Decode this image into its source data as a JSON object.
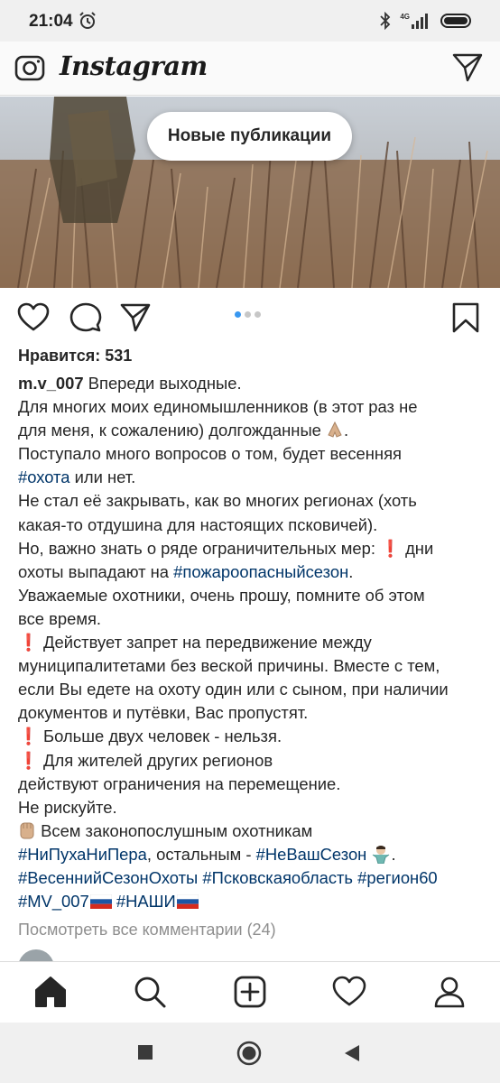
{
  "status_bar": {
    "time": "21:04",
    "network": "4G"
  },
  "app": {
    "title": "Instagram",
    "new_posts_label": "Новые публикации"
  },
  "post": {
    "likes": "Нравится: 531",
    "username": "m.v_007",
    "carousel_pages": 3,
    "carousel_active": 1,
    "view_comments": "Посмотреть все комментарии (24)",
    "caption_lines": {
      "l1": "Впереди выходные.",
      "l2": "Для многих моих единомышленников (в этот раз не",
      "l3": "для меня, к сожалению) долгожданные",
      "l3_end": ".",
      "l4": "Поступало много вопросов о том, будет весенняя",
      "l5_tag": "#охота",
      "l5_rest": " или нет.",
      "l6": "Не стал её закрывать, как во многих регионах (хоть",
      "l7": "какая-то отдушина для настоящих псковичей).",
      "l8": "Но, важно знать о ряде ограничительных мер: ",
      "l8_mark": "❗",
      "l8_end": "дни",
      "l9": "охоты выпадают на ",
      "l9_tag": "#пожароопасныйсезон",
      "l9_end": ".",
      "l10": "Уважаемые охотники, очень прошу, помните об этом",
      "l11": "все время.",
      "l12_mark": "❗",
      "l12": "Действует запрет на передвижение между",
      "l13": "муниципалитетами без веской причины. Вместе с тем,",
      "l14": "если Вы едете на охоту один или с сыном, при наличии",
      "l15": "документов и путёвки, Вас пропустят.",
      "l16_mark": "❗",
      "l16": "Больше двух человек - нельзя.",
      "l17_mark": "❗",
      "l17": "Для жителей других регионов",
      "l18": "действуют ограничения на перемещение.",
      "l19": "Не рискуйте.",
      "l20": " Всем законопослушным охотникам",
      "l21_tag1": "#НиПухаНиПера",
      "l21_mid": ", остальным - ",
      "l21_tag2": "#НеВашСезон",
      "l21_end": ".",
      "l22_tag1": "#ВесеннийСезонОхоты",
      "l22_tag2": "#Псковскаяобласть",
      "l22_tag3": "#регион60",
      "l23_tag1": "#MV_007",
      "l23_tag2": "#НАШИ"
    }
  },
  "icons": {
    "camera": "camera-icon",
    "direct": "direct-message-icon",
    "like": "heart-icon",
    "comment": "comment-icon",
    "share": "share-icon",
    "save": "bookmark-icon",
    "home": "home-icon",
    "search": "search-icon",
    "new_post": "add-post-icon",
    "activity": "heart-icon",
    "profile": "profile-icon"
  },
  "colors": {
    "hashtag": "#003569",
    "carousel_active": "#3897f0",
    "warning": "#e0222a",
    "muted": "#8e8e8e"
  }
}
